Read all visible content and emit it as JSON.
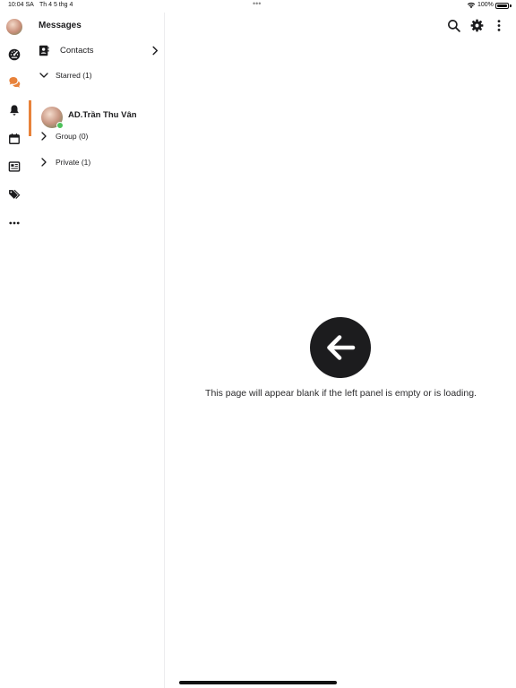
{
  "status_bar": {
    "time": "10:04 SA",
    "date": "Th 4 5 thg 4",
    "dots": "•••",
    "battery_percent": "100%",
    "battery_level": 1.0,
    "wifi_icon": "wifi-icon"
  },
  "rail": {
    "items": [
      {
        "name": "avatar",
        "icon": "avatar"
      },
      {
        "name": "dashboard",
        "icon": "gauge-icon"
      },
      {
        "name": "messages",
        "icon": "chat-bubbles-icon",
        "color": "#e8823a"
      },
      {
        "name": "notifications",
        "icon": "bell-icon"
      },
      {
        "name": "calendar",
        "icon": "calendar-icon"
      },
      {
        "name": "news",
        "icon": "newspaper-icon"
      },
      {
        "name": "tags",
        "icon": "tags-icon"
      },
      {
        "name": "more",
        "icon": "ellipsis-icon"
      }
    ]
  },
  "left_panel": {
    "title": "Messages",
    "contacts_label": "Contacts",
    "groups": [
      {
        "label": "Starred (1)",
        "expanded": true
      },
      {
        "label": "Group (0)",
        "expanded": false
      },
      {
        "label": "Private (1)",
        "expanded": false
      }
    ],
    "starred_contact": {
      "name": "AD.Trần Thu Vân",
      "online": true
    }
  },
  "main": {
    "toolbar_icons": [
      "search-icon",
      "gear-icon",
      "vertical-ellipsis-icon"
    ],
    "empty_message": "This page will appear blank if the left panel is empty or is loading.",
    "empty_icon": "arrow-left-icon"
  },
  "colors": {
    "accent": "#e8823a",
    "online": "#4cc15a",
    "text": "#1c1c1e"
  }
}
